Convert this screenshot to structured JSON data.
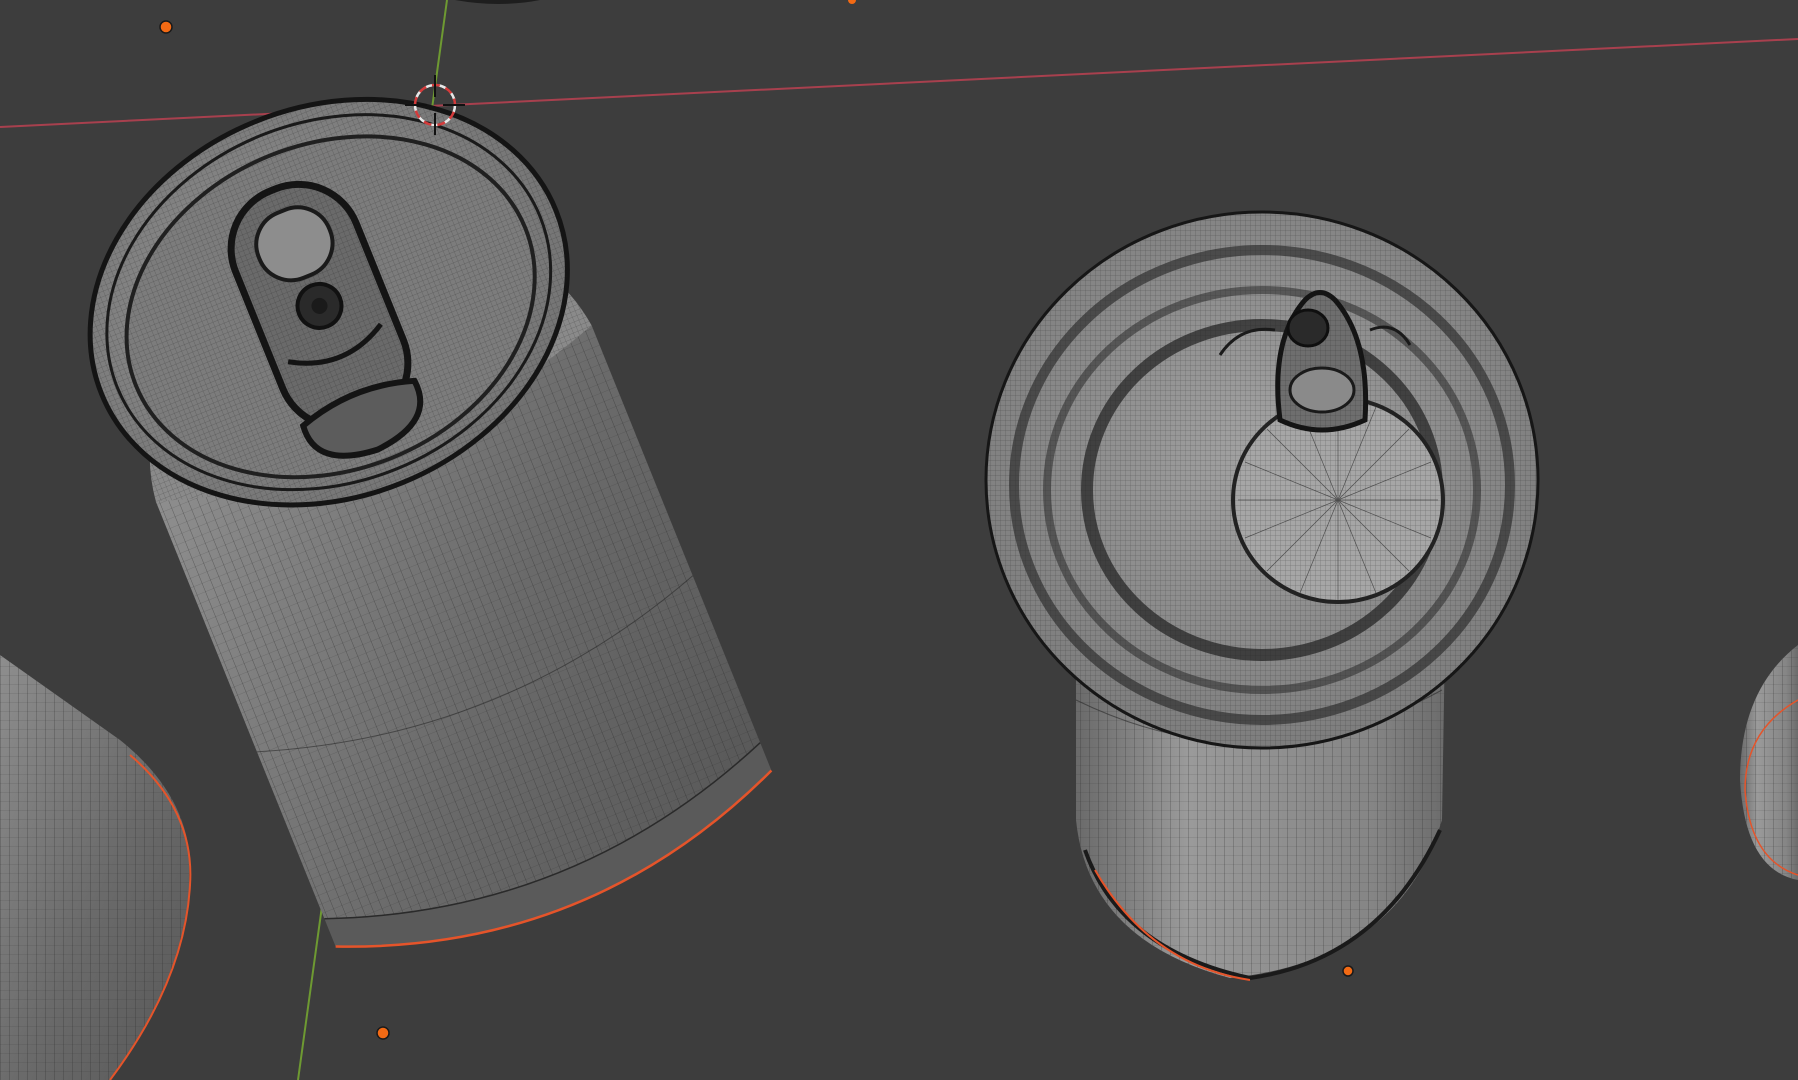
{
  "app": {
    "name": "3D viewport",
    "mode": "object-mode",
    "shading": "solid-with-wireframe-overlay"
  },
  "colors": {
    "background": "#3d3d3d",
    "x_axis": "#a8404e",
    "y_axis": "#6e9a32",
    "origin_dot": "#f36a14",
    "selection_outline": "#e5542a",
    "mesh_light": "#8a8a8a",
    "mesh_dark": "#4e4e4e",
    "wire": "#222222"
  },
  "scene": {
    "objects": [
      {
        "name": "can-large-pull-tab",
        "selected": false
      },
      {
        "name": "can-short-ring-pull",
        "selected": false
      },
      {
        "name": "can-partial-left",
        "selected": false
      },
      {
        "name": "can-partial-right",
        "selected": false
      }
    ],
    "origin_markers": 4,
    "cursor": "3d-cursor"
  }
}
